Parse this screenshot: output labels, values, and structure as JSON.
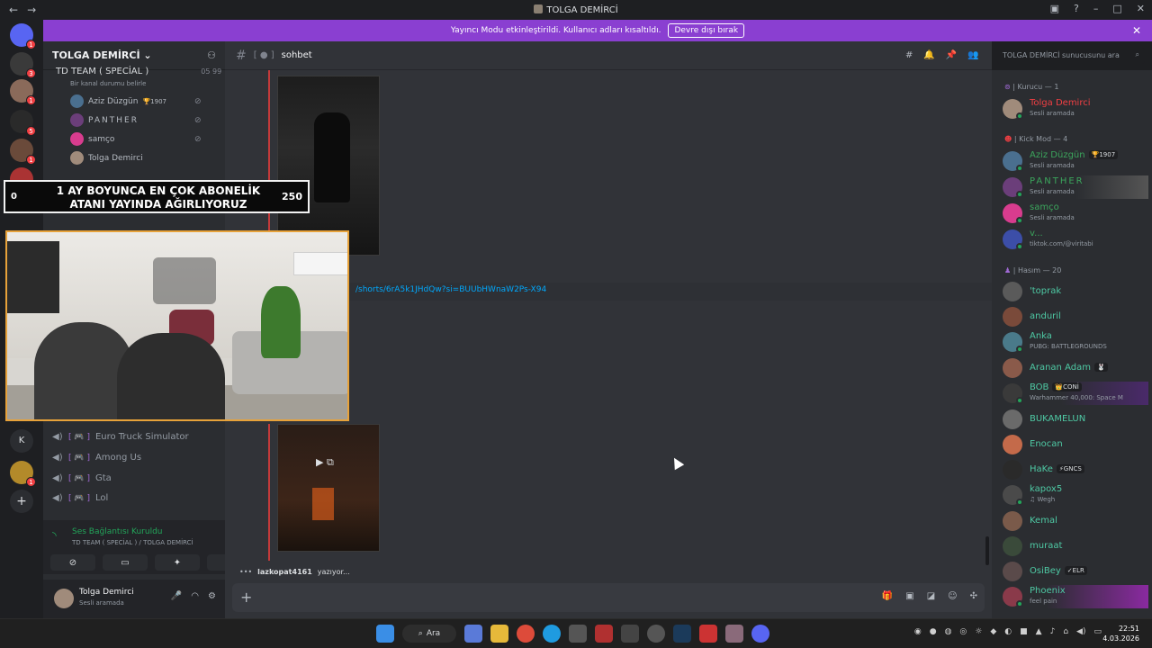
{
  "window": {
    "title": "TOLGA DEMİRCİ"
  },
  "banner": {
    "message": "Yayıncı Modu etkinleştirildi. Kullanıcı adları kısaltıldı.",
    "button": "Devre dışı bırak"
  },
  "server": {
    "name": "TOLGA DEMİRCİ",
    "voice_channel": "TD TEAM ( SPECİAL )",
    "voice_counts": "05   99",
    "voice_status": "Bir kanal durumu belirle",
    "voice_members": [
      {
        "name": "Aziz Düzgün",
        "badge": "1907",
        "color": "#4a6f8f"
      },
      {
        "name": "PANTHER",
        "badge": "",
        "color": "#6b3e7a"
      },
      {
        "name": "samço",
        "badge": "",
        "color": "#d83c8e"
      },
      {
        "name": "Tolga Demirci",
        "badge": "",
        "color": "#a08b7b"
      }
    ],
    "channels": [
      "Euro Truck Simulator",
      "Among Us",
      "Gta",
      "Lol"
    ]
  },
  "voice_panel": {
    "title": "Ses Bağlantısı Kuruldu",
    "subtitle": "TD TEAM ( SPECİAL ) / TOLGA DEMİRCİ"
  },
  "user_panel": {
    "name": "Tolga Demirci",
    "status": "Sesli aramada"
  },
  "channel": {
    "name": "sohbet",
    "search_placeholder": "TOLGA DEMİRCİ sunucusunu ara"
  },
  "chat": {
    "link": "/shorts/6rA5k1JHdQw?si=BUUbHWnaW2Ps-X94",
    "typing_user": "lazkopat4161",
    "typing_text": "yazıyor..."
  },
  "overlay": {
    "line1": "1 AY BOYUNCA EN ÇOK ABONELİK",
    "line2": "ATANI YAYINDA AĞIRLIYORUZ",
    "left_count": "0",
    "goal": "250"
  },
  "members": {
    "groups": [
      {
        "label": "| Kurucu — 1"
      },
      {
        "label": "| Kick Mod — 4"
      },
      {
        "label": "| Hasım — 20"
      }
    ],
    "list": [
      {
        "name": "Tolga Demirci",
        "activity": "Sesli aramada",
        "tag": "",
        "name_color": "#f23f43",
        "av": "#a08b7b"
      },
      {
        "name": "Aziz Düzgün",
        "activity": "Sesli aramada",
        "tag": "1907",
        "name_color": "#3ba55c",
        "av": "#4a6f8f"
      },
      {
        "name": "PANTHER",
        "activity": "Sesli aramada",
        "tag": "",
        "name_color": "#3ba55c",
        "av": "#6b3e7a"
      },
      {
        "name": "samço",
        "activity": "Sesli aramada",
        "tag": "",
        "name_color": "#3ba55c",
        "av": "#d83c8e"
      },
      {
        "name": "v...",
        "activity": "tiktok.com/@viritabi",
        "tag": "",
        "name_color": "#3ba55c",
        "av": "#3c4ea8"
      },
      {
        "name": "'toprak",
        "activity": "",
        "tag": "",
        "name_color": "#4ec9a4",
        "av": "#5a5a5a"
      },
      {
        "name": "anduril",
        "activity": "",
        "tag": "",
        "name_color": "#4ec9a4",
        "av": "#7a4a3a"
      },
      {
        "name": "Anka",
        "activity": "PUBG: BATTLEGROUNDS",
        "tag": "",
        "name_color": "#4ec9a4",
        "av": "#4a7a8a"
      },
      {
        "name": "Aranan Adam",
        "activity": "",
        "tag": "",
        "name_color": "#4ec9a4",
        "av": "#8a5a4a"
      },
      {
        "name": "BOB",
        "activity": "Warhammer 40,000: Space M",
        "tag": "CONİ",
        "name_color": "#4ec9a4",
        "av": "#3a3a3a"
      },
      {
        "name": "BUKAMELUN",
        "activity": "",
        "tag": "",
        "name_color": "#4ec9a4",
        "av": "#6a6a6a"
      },
      {
        "name": "Enocan",
        "activity": "",
        "tag": "",
        "name_color": "#4ec9a4",
        "av": "#c46a4a"
      },
      {
        "name": "HaKe",
        "activity": "",
        "tag": "GNCS",
        "name_color": "#4ec9a4",
        "av": "#2a2a2a"
      },
      {
        "name": "kapox5",
        "activity": "Wegh",
        "tag": "",
        "name_color": "#4ec9a4",
        "av": "#4a4a4a"
      },
      {
        "name": "Kemal",
        "activity": "",
        "tag": "",
        "name_color": "#4ec9a4",
        "av": "#7a5a4a"
      },
      {
        "name": "muraat",
        "activity": "",
        "tag": "",
        "name_color": "#4ec9a4",
        "av": "#3a4a3a"
      },
      {
        "name": "OsiBey",
        "activity": "",
        "tag": "ELR",
        "name_color": "#4ec9a4",
        "av": "#5a4a4a"
      },
      {
        "name": "Phoenix",
        "activity": "feel pain",
        "tag": "",
        "name_color": "#4ec9a4",
        "av": "#8a3a4a"
      }
    ]
  },
  "taskbar": {
    "search": "Ara",
    "time": "22:51",
    "date": "4.03.2026"
  },
  "colors": {
    "accent": "#8a3fd1",
    "online": "#23a55a",
    "link": "#00a8fc"
  }
}
